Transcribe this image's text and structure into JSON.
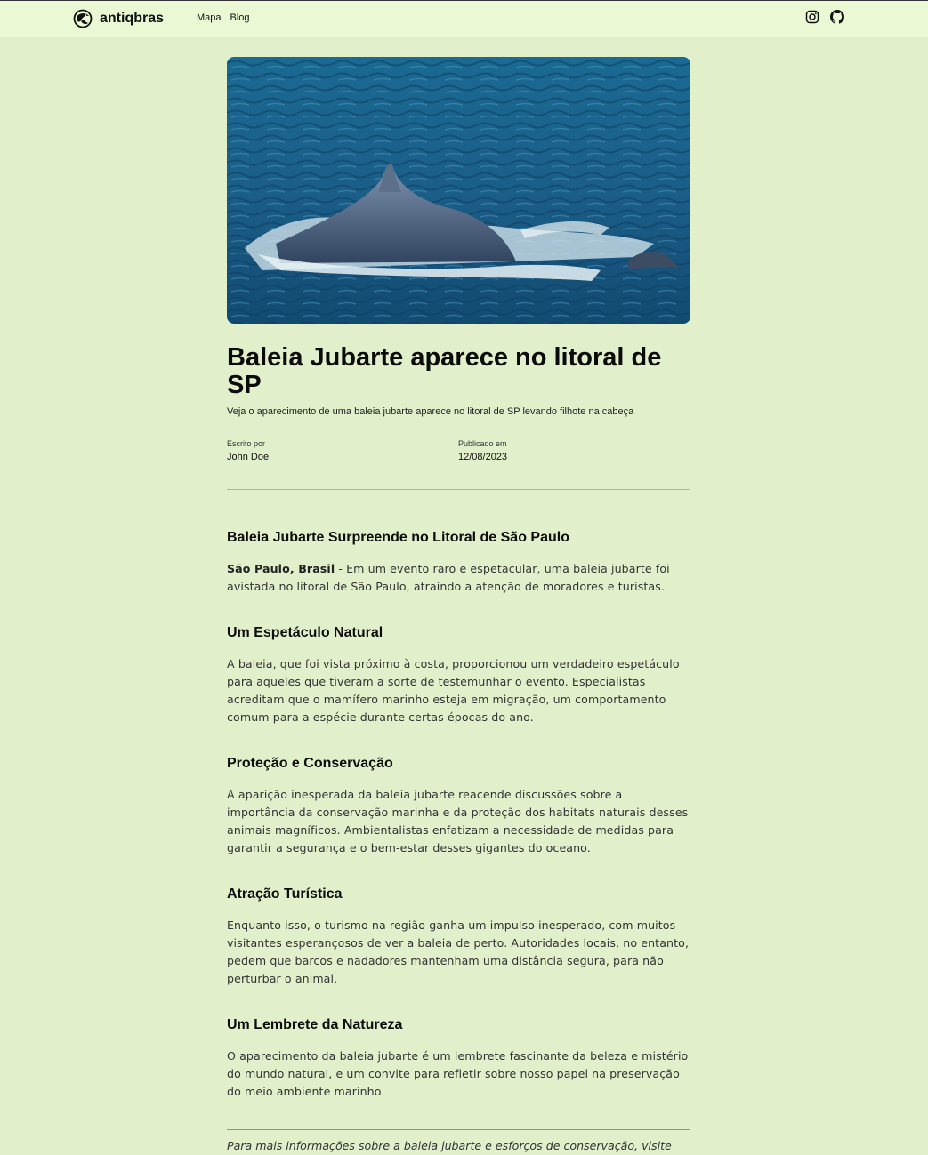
{
  "header": {
    "brand": "antiqbras",
    "nav": [
      "Mapa",
      "Blog"
    ],
    "social_icons": [
      "instagram-icon",
      "github-icon"
    ]
  },
  "article": {
    "title": "Baleia Jubarte aparece no litoral de SP",
    "subtitle": "Veja o aparecimento de uma baleia jubarte aparece no litoral de SP levando filhote na cabeça",
    "meta": {
      "author_label": "Escrito por",
      "author": "John Doe",
      "published_label": "Publicado em",
      "published": "12/08/2023"
    },
    "sections": [
      {
        "heading": "Baleia Jubarte Surpreende no Litoral de São Paulo",
        "lead_bold": "São Paulo, Brasil",
        "text": " - Em um evento raro e espetacular, uma baleia jubarte foi avistada no litoral de São Paulo, atraindo a atenção de moradores e turistas."
      },
      {
        "heading": "Um Espetáculo Natural",
        "text": "A baleia, que foi vista próximo à costa, proporcionou um verdadeiro espetáculo para aqueles que tiveram a sorte de testemunhar o evento. Especialistas acreditam que o mamífero marinho esteja em migração, um comportamento comum para a espécie durante certas épocas do ano."
      },
      {
        "heading": "Proteção e Conservação",
        "text": "A aparição inesperada da baleia jubarte reacende discussões sobre a importância da conservação marinha e da proteção dos habitats naturais desses animais magníficos. Ambientalistas enfatizam a necessidade de medidas para garantir a segurança e o bem-estar desses gigantes do oceano."
      },
      {
        "heading": "Atração Turística",
        "text": "Enquanto isso, o turismo na região ganha um impulso inesperado, com muitos visitantes esperançosos de ver a baleia de perto. Autoridades locais, no entanto, pedem que barcos e nadadores mantenham uma distância segura, para não perturbar o animal."
      },
      {
        "heading": "Um Lembrete da Natureza",
        "text": "O aparecimento da baleia jubarte é um lembrete fascinante da beleza e mistério do mundo natural, e um convite para refletir sobre nosso papel na preservação do meio ambiente marinho."
      }
    ],
    "footnote": "Para mais informações sobre a baleia jubarte e esforços de conservação, visite"
  }
}
